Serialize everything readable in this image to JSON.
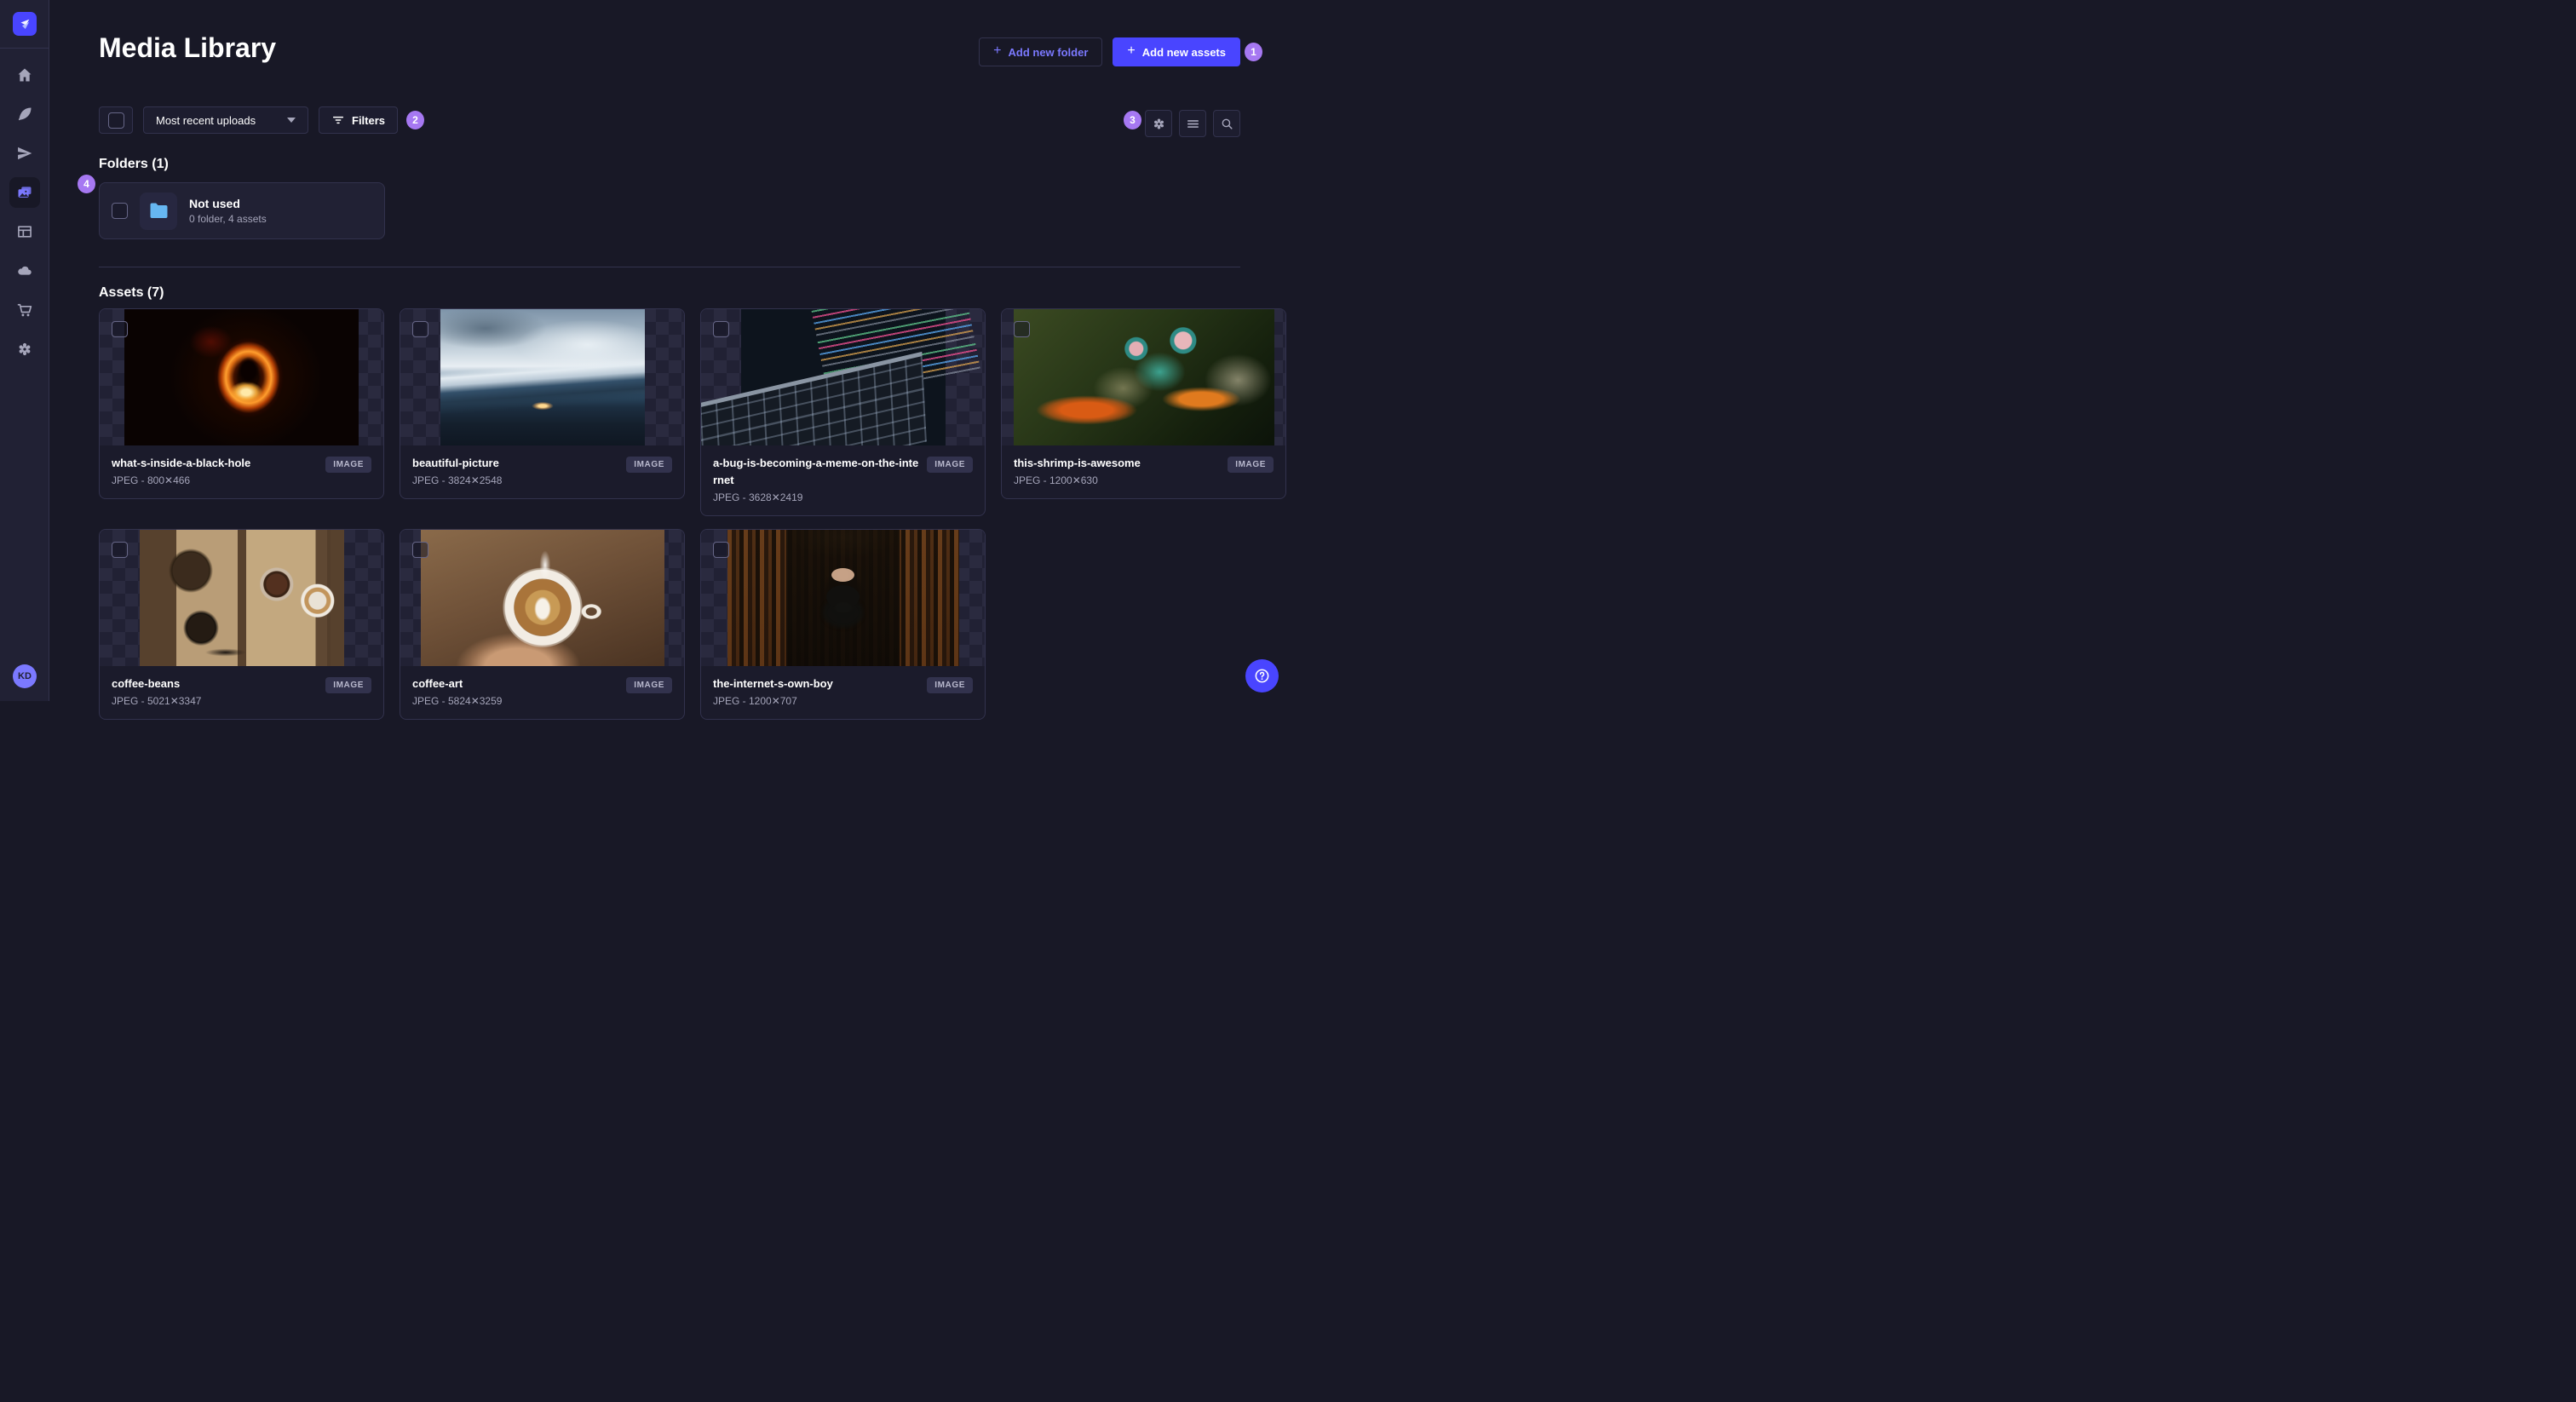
{
  "header": {
    "title": "Media Library",
    "add_folder_label": "Add new folder",
    "add_assets_label": "Add new assets",
    "plus": "+"
  },
  "sidebar": {
    "items": [
      {
        "label": "home"
      },
      {
        "label": "content"
      },
      {
        "label": "release"
      },
      {
        "label": "media-library",
        "active": true
      },
      {
        "label": "content-manager"
      },
      {
        "label": "deploy"
      },
      {
        "label": "marketplace"
      },
      {
        "label": "settings"
      }
    ],
    "avatar_initials": "KD"
  },
  "toolbar": {
    "sort_value": "Most recent uploads",
    "filters_label": "Filters"
  },
  "annotations": {
    "badge1": "1",
    "badge2": "2",
    "badge3": "3",
    "badge4": "4"
  },
  "folders_section": {
    "title": "Folders (1)",
    "folder": {
      "name": "Not used",
      "meta": "0 folder, 4 assets"
    }
  },
  "assets_section": {
    "title": "Assets (7)",
    "assets": [
      {
        "name": "what-s-inside-a-black-hole",
        "meta": "JPEG - 800✕466",
        "type_label": "IMAGE",
        "thumb": "blackhole"
      },
      {
        "name": "beautiful-picture",
        "meta": "JPEG - 3824✕2548",
        "type_label": "IMAGE",
        "thumb": "mountains"
      },
      {
        "name": "a-bug-is-becoming-a-meme-on-the-internet",
        "meta": "JPEG - 3628✕2419",
        "type_label": "IMAGE",
        "thumb": "laptop"
      },
      {
        "name": "this-shrimp-is-awesome",
        "meta": "JPEG - 1200✕630",
        "type_label": "IMAGE",
        "thumb": "shrimp"
      },
      {
        "name": "coffee-beans",
        "meta": "JPEG - 5021✕3347",
        "type_label": "IMAGE",
        "thumb": "beans"
      },
      {
        "name": "coffee-art",
        "meta": "JPEG - 5824✕3259",
        "type_label": "IMAGE",
        "thumb": "latte"
      },
      {
        "name": "the-internet-s-own-boy",
        "meta": "JPEG - 1200✕707",
        "type_label": "IMAGE",
        "thumb": "library"
      }
    ]
  },
  "colors": {
    "accent": "#4945ff",
    "accent_light": "#7b79ff",
    "annotation_badge": "#a678f2",
    "folder_icon": "#66b7f2",
    "background": "#181826",
    "surface": "#212134",
    "border": "#32324d"
  }
}
